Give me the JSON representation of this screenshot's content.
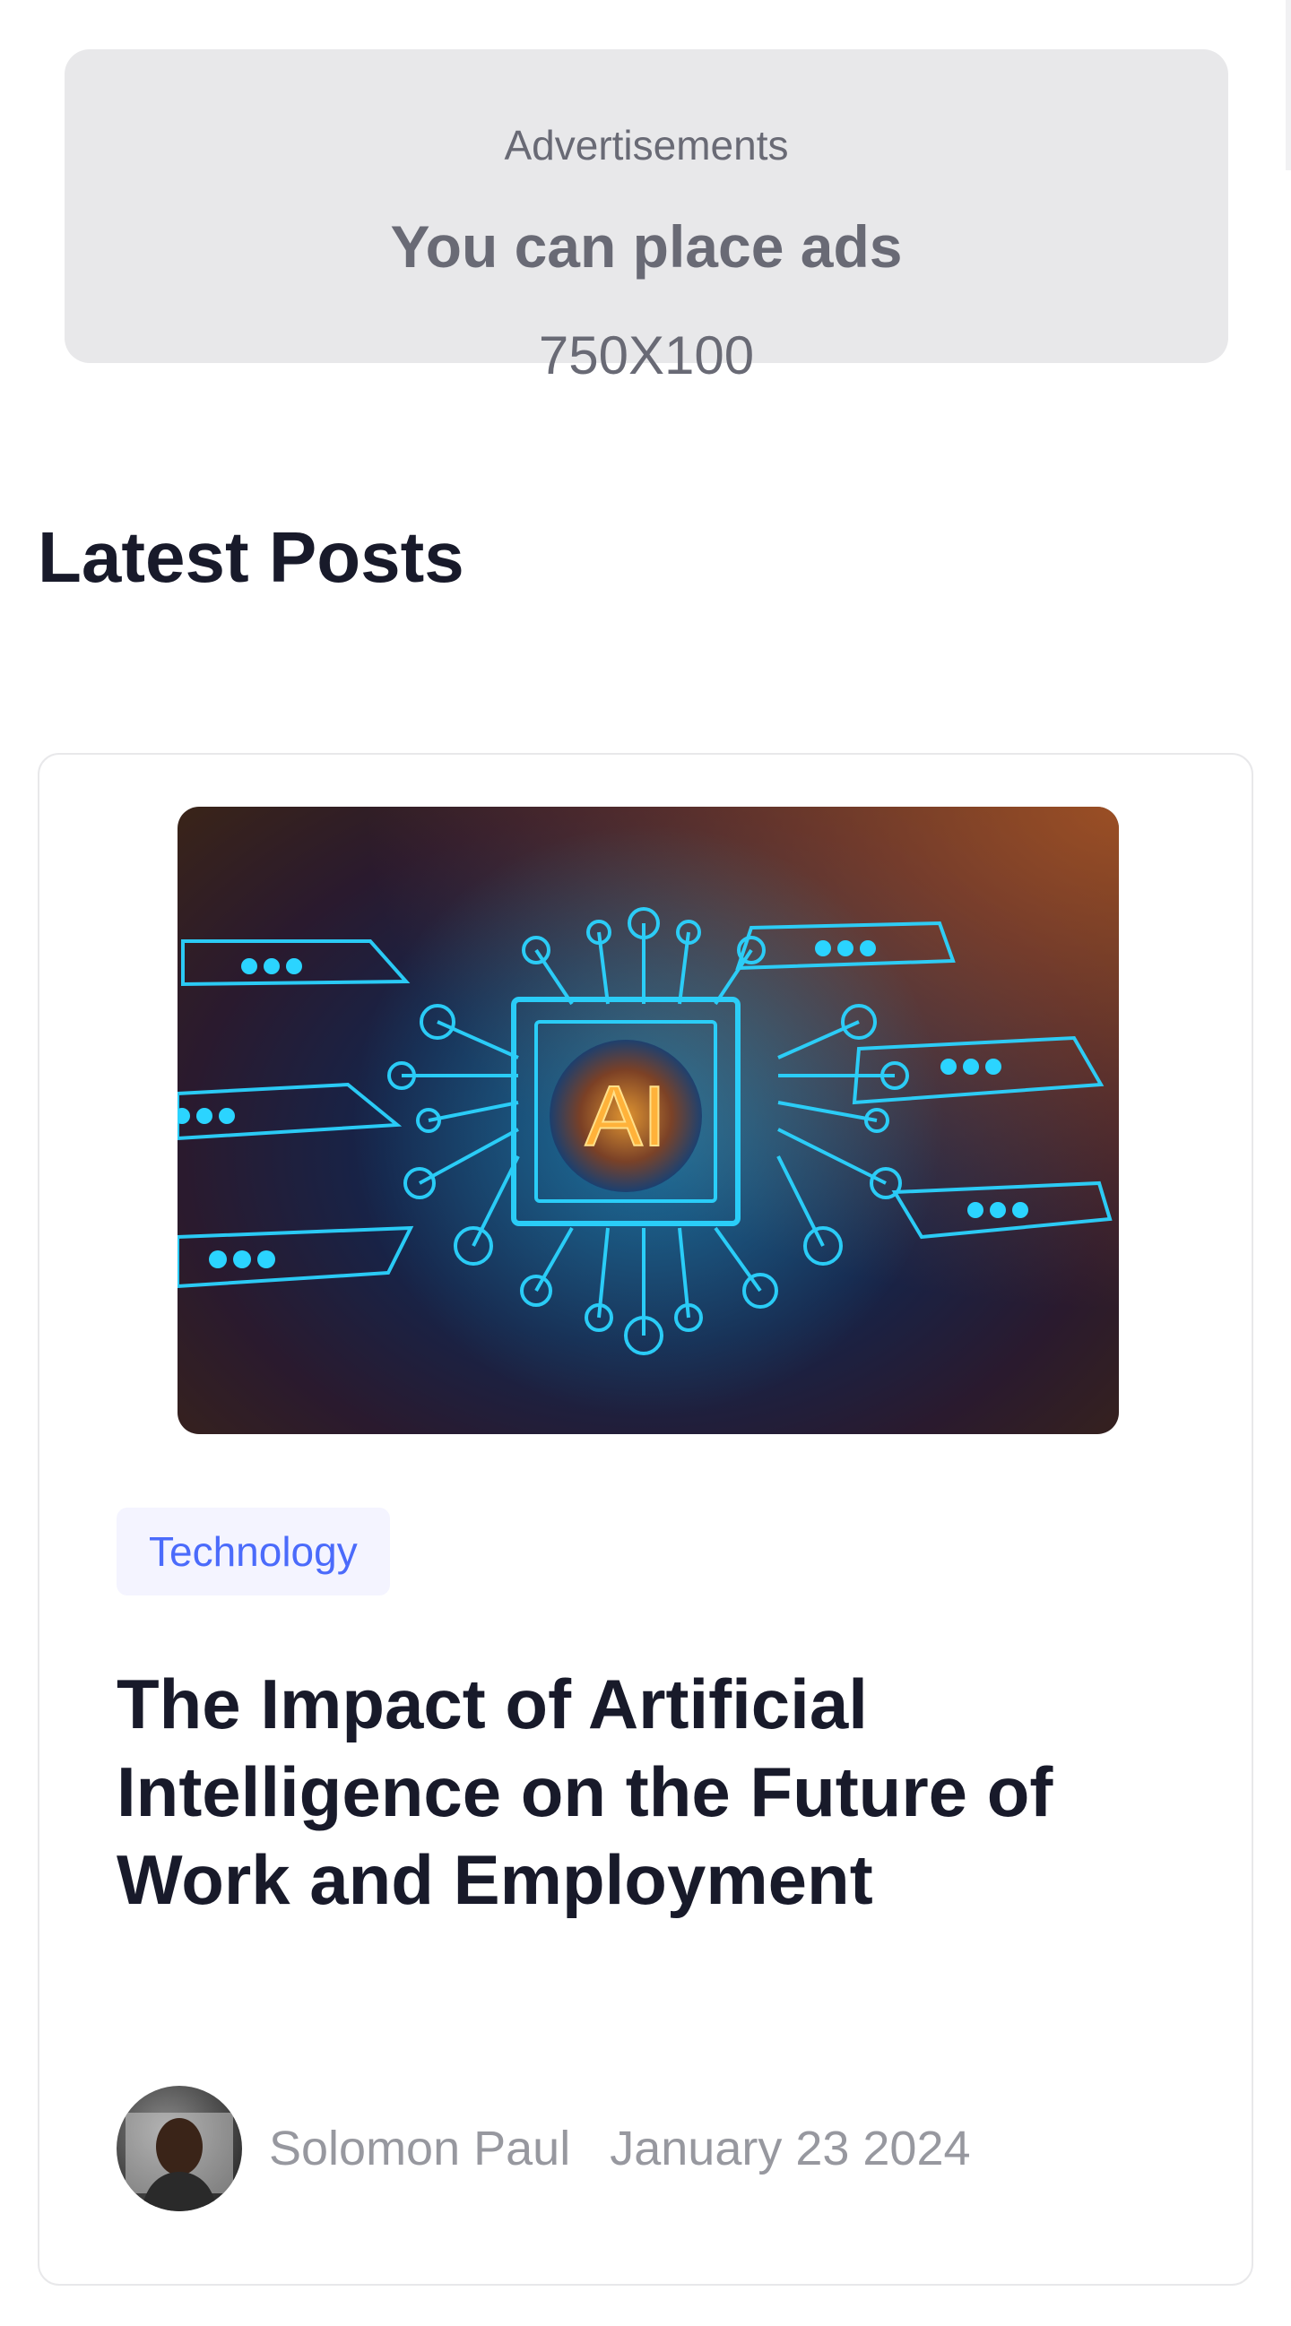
{
  "advertisement": {
    "label": "Advertisements",
    "headline": "You can place ads",
    "size": "750X100"
  },
  "latest_posts": {
    "title": "Latest Posts",
    "posts": [
      {
        "image_icon": "ai-chip-illustration",
        "image_text": "AI",
        "category": "Technology",
        "title": "The Impact of Artificial Intelligence on the Future of Work and Employment",
        "author": "Solomon Paul",
        "date": "January 23 2024"
      }
    ]
  },
  "colors": {
    "accent": "#4b6bfb",
    "heading": "#181a2a",
    "muted": "#97989f",
    "ad_background": "#e8e8ea"
  }
}
